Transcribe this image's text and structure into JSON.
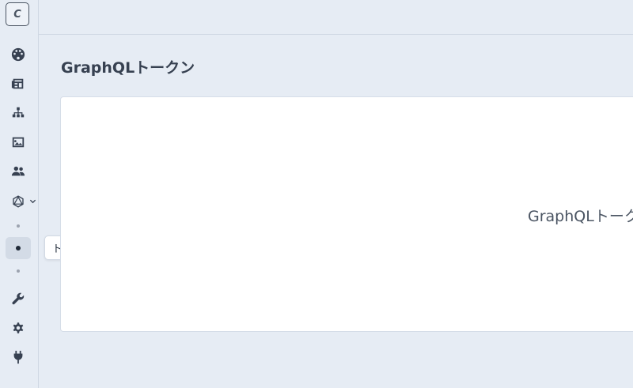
{
  "logo": {
    "letter": "C"
  },
  "sidebar": {
    "items": [
      {
        "name": "dashboard",
        "icon": "palette-icon"
      },
      {
        "name": "content",
        "icon": "newspaper-icon"
      },
      {
        "name": "structure",
        "icon": "sitemap-icon"
      },
      {
        "name": "media",
        "icon": "image-icon"
      },
      {
        "name": "users",
        "icon": "users-icon"
      },
      {
        "name": "graphql",
        "icon": "graphql-icon",
        "expanded": true
      },
      {
        "name": "tools",
        "icon": "wrench-icon"
      },
      {
        "name": "settings",
        "icon": "gear-icon"
      },
      {
        "name": "plugins",
        "icon": "plug-icon"
      }
    ],
    "tooltip": "トークン"
  },
  "main": {
    "title": "GraphQLトークン",
    "card_text": "GraphQLトークン"
  },
  "colors": {
    "background": "#e6ecf4",
    "card": "#ffffff",
    "text": "#374151"
  }
}
